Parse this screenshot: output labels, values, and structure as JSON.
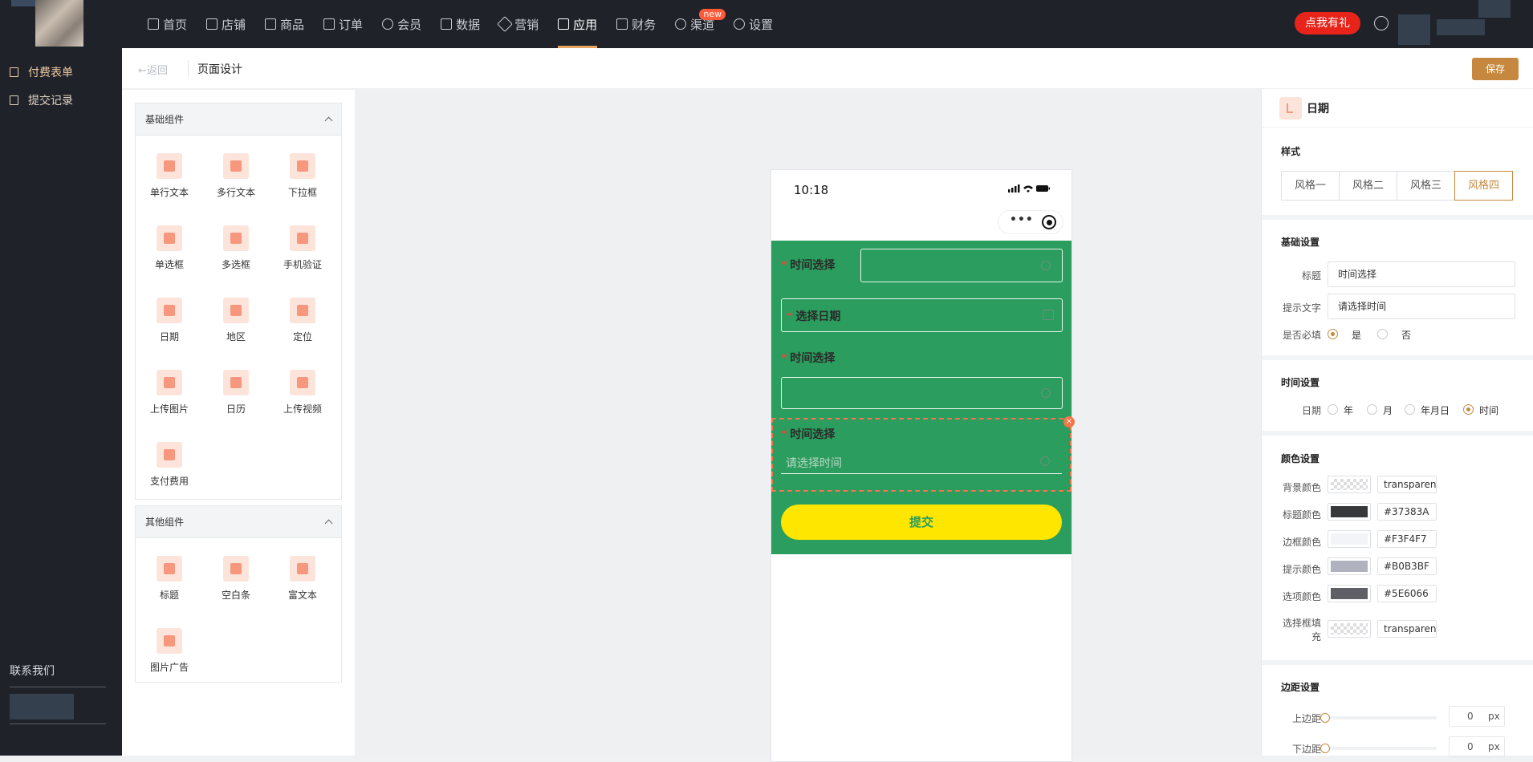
{
  "nav": {
    "items": [
      {
        "label": "首页",
        "icon": "home-icon"
      },
      {
        "label": "店铺",
        "icon": "store-icon"
      },
      {
        "label": "商品",
        "icon": "goods-icon"
      },
      {
        "label": "订单",
        "icon": "order-icon"
      },
      {
        "label": "会员",
        "icon": "member-icon"
      },
      {
        "label": "数据",
        "icon": "data-icon"
      },
      {
        "label": "营销",
        "icon": "tag-icon"
      },
      {
        "label": "应用",
        "icon": "app-icon"
      },
      {
        "label": "财务",
        "icon": "finance-icon"
      },
      {
        "label": "渠道",
        "icon": "channel-icon"
      },
      {
        "label": "设置",
        "icon": "gear-icon"
      }
    ],
    "active": "应用",
    "new_badge": "new",
    "promo": "点我有礼"
  },
  "sidebar": {
    "items": [
      {
        "label": "付费表单"
      },
      {
        "label": "提交记录"
      }
    ],
    "contact": "联系我们"
  },
  "header": {
    "back": "返回",
    "title": "页面设计",
    "save": "保存"
  },
  "library": {
    "basic": {
      "title": "基础组件",
      "items": [
        "单行文本",
        "多行文本",
        "下拉框",
        "单选框",
        "多选框",
        "手机验证",
        "日期",
        "地区",
        "定位",
        "上传图片",
        "日历",
        "上传视频",
        "支付费用"
      ]
    },
    "other": {
      "title": "其他组件",
      "items": [
        "标题",
        "空白条",
        "富文本",
        "图片广告"
      ]
    }
  },
  "phone": {
    "time": "10:18",
    "fields": [
      {
        "label": "时间选择"
      },
      {
        "label": "选择日期"
      },
      {
        "label": "时间选择"
      },
      {
        "label": "时间选择",
        "placeholder": "请选择时间"
      }
    ],
    "submit": "提交",
    "colors": {
      "background": "#2b9d5e",
      "button": "#ffe600"
    }
  },
  "props": {
    "title": "日期",
    "style_section": "样式",
    "styles": [
      "风格一",
      "风格二",
      "风格三",
      "风格四"
    ],
    "style_selected": "风格四",
    "basic": {
      "section": "基础设置",
      "title_label": "标题",
      "title_value": "时间选择",
      "hint_label": "提示文字",
      "hint_value": "请选择时间",
      "required_label": "是否必填",
      "yes": "是",
      "no": "否",
      "required": "是"
    },
    "time": {
      "section": "时间设置",
      "date_label": "日期",
      "options": [
        "年",
        "月",
        "年月日",
        "时间"
      ],
      "selected": "时间"
    },
    "colors": {
      "section": "颜色设置",
      "rows": [
        {
          "label": "背景颜色",
          "value": "transparent",
          "swatch": "transparent"
        },
        {
          "label": "标题颜色",
          "value": "#37383A",
          "swatch": "#37383A"
        },
        {
          "label": "边框颜色",
          "value": "#F3F4F7",
          "swatch": "#F3F4F7"
        },
        {
          "label": "提示颜色",
          "value": "#B0B3BF",
          "swatch": "#B0B3BF"
        },
        {
          "label": "选项颜色",
          "value": "#5E6066",
          "swatch": "#5E6066"
        },
        {
          "label": "选择框填充",
          "value": "transparent",
          "swatch": "transparent"
        }
      ]
    },
    "margin": {
      "section": "边距设置",
      "top_label": "上边距",
      "top_value": "0",
      "bottom_label": "下边距",
      "bottom_value": "0",
      "unit": "px"
    }
  }
}
